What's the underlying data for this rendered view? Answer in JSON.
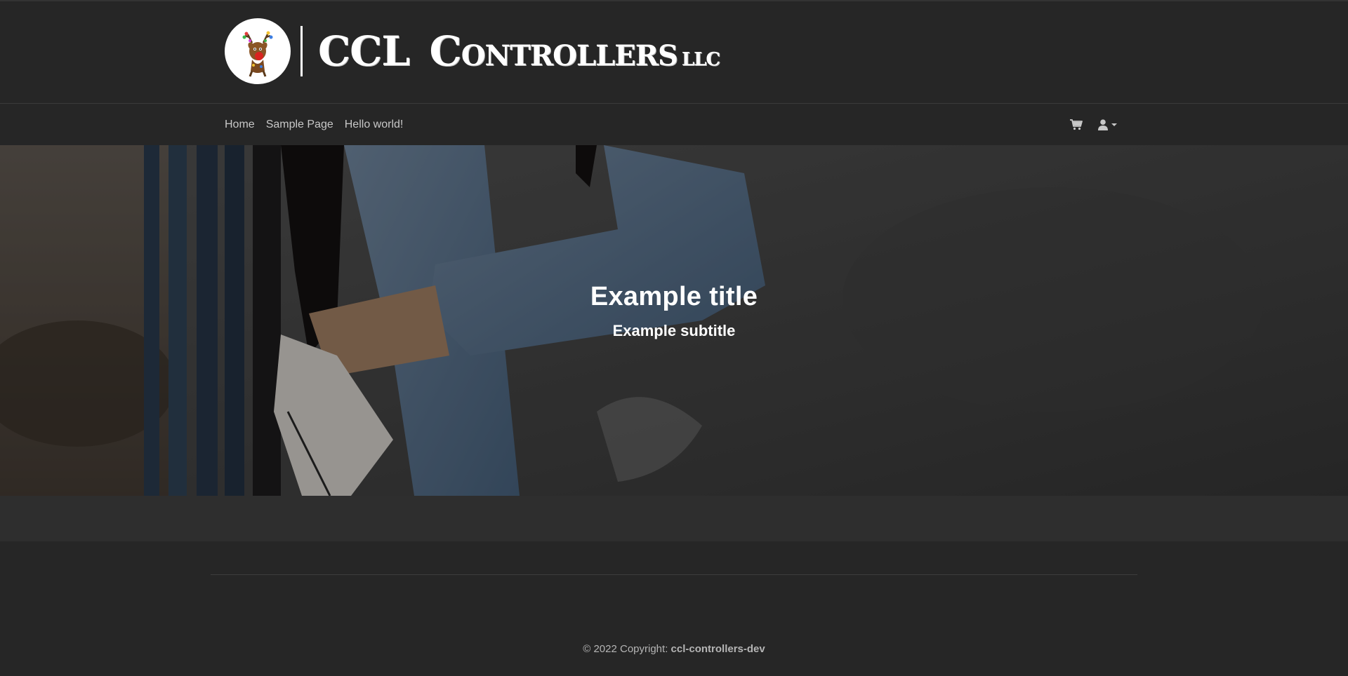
{
  "brand": {
    "logo_icon": "reindeer-with-lights-icon",
    "name_part1": "CCL",
    "name_part2_initial": "C",
    "name_part2_rest": "ONTROLLERS",
    "name_suffix": "LLC"
  },
  "nav": {
    "links": [
      "Home",
      "Sample Page",
      "Hello world!"
    ],
    "cart_icon": "cart-icon",
    "user_icon": "user-icon",
    "user_dropdown_icon": "caret-down-icon"
  },
  "hero": {
    "title": "Example title",
    "subtitle": "Example subtitle"
  },
  "footer": {
    "copyright_prefix": "© 2022 Copyright: ",
    "copyright_owner": "ccl-controllers-dev"
  },
  "colors": {
    "background": "#262626",
    "nav_text": "#c8c8c8",
    "footer_text": "#b5b5b5",
    "strip": "#2e2e2e"
  }
}
